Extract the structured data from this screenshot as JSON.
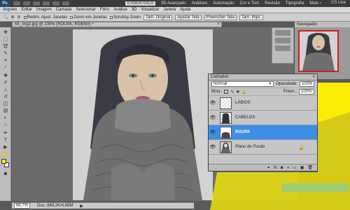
{
  "app": {
    "logo": "Ps",
    "workspaces": [
      "ESSENTIALS",
      "3D Avançado",
      "Análises",
      "Automação",
      "Cor e Tom",
      "Revisão",
      "Tipografia",
      "Mais ›"
    ],
    "cslive": "CS Live"
  },
  "menu": [
    "Arquivo",
    "Editar",
    "Imagem",
    "Camada",
    "Selecionar",
    "Filtro",
    "Análise",
    "3D",
    "Visualizar",
    "Janela",
    "Ajuda"
  ],
  "options": {
    "resize_windows": "Redim. Ajust. Janelas",
    "zoom_all": "Zoom em Janelas",
    "scrubby_zoom": "Scrubby Zoom",
    "actual_pixels": "Tam. Original",
    "fit_screen": "Ajustar Tela",
    "fill_screen": "Preencher Tela",
    "print_size": "Tam. Impr."
  },
  "document": {
    "tab_label": "64_img3.jpg @ 100% (ROUPA, RGB/8#) *",
    "zoom": "66,7%",
    "doc_info": "Doc: 889,2K/4,69M"
  },
  "navigator": {
    "title": "Navegador"
  },
  "layers_panel": {
    "title": "Camadas",
    "blend_mode": "Normal",
    "opacity_label": "Opacidade:",
    "opacity_value": "100%",
    "lock_label": "Bloq.:",
    "fill_label": "Preen.:",
    "fill_value": "100%",
    "layers": [
      {
        "name": "LÁBIOS",
        "selected": false,
        "italic": false,
        "locked": false
      },
      {
        "name": "CABELOS",
        "selected": false,
        "italic": false,
        "locked": false
      },
      {
        "name": "ROUPA",
        "selected": true,
        "italic": false,
        "locked": false
      },
      {
        "name": "Plano de Fundo",
        "selected": false,
        "italic": true,
        "locked": true
      }
    ]
  },
  "colors": {
    "foreground": "#ffee00",
    "background": "#ffffff",
    "selection": "#3b8fe8",
    "highlight": "#fff200"
  }
}
